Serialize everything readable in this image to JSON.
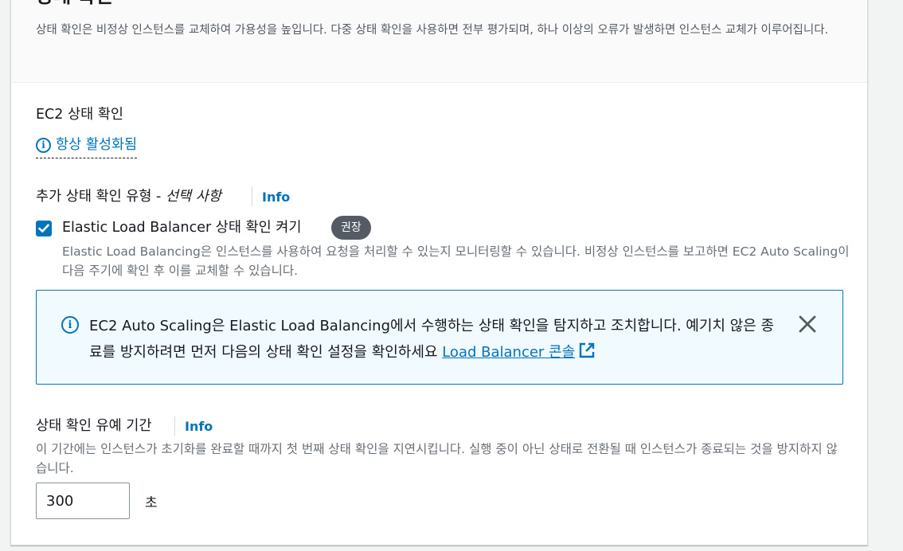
{
  "section": {
    "title": "상태 확인",
    "description": "상태 확인은 비정상 인스턴스를 교체하여 가용성을 높입니다. 다중 상태 확인을 사용하면 전부 평가되며, 하나 이상의 오류가 발생하면 인스턴스 교체가 이루어집니다."
  },
  "ec2_health": {
    "label": "EC2 상태 확인",
    "always_on": "항상 활성화됨"
  },
  "additional_types": {
    "label": "추가 상태 확인 유형 - ",
    "optional": "선택 사항",
    "info": "Info"
  },
  "elb_checkbox": {
    "label": "Elastic Load Balancer 상태 확인 켜기",
    "checked": true,
    "badge": "권장",
    "help": "Elastic Load Balancing은 인스턴스를 사용하여 요청을 처리할 수 있는지 모니터링할 수 있습니다. 비정상 인스턴스를 보고하면 EC2 Auto Scaling이 다음 주기에 확인 후 이를 교체할 수 있습니다."
  },
  "alert": {
    "text": "EC2 Auto Scaling은 Elastic Load Balancing에서 수행하는 상태 확인을 탐지하고 조치합니다. 예기치 않은 종료를 방지하려면 먼저 다음의 상태 확인 설정을 확인하세요 ",
    "link": "Load Balancer 콘솔"
  },
  "grace_period": {
    "label": "상태 확인 유예 기간",
    "info": "Info",
    "help": "이 기간에는 인스턴스가 초기화를 완료할 때까지 첫 번째 상태 확인을 지연시킵니다. 실행 중이 아닌 상태로 전환될 때 인스턴스가 종료되는 것을 방지하지 않습니다.",
    "value": "300",
    "unit": "초"
  },
  "colors": {
    "accent": "#0073bb",
    "badge": "#545b64",
    "alert_bg": "#f1faff"
  }
}
